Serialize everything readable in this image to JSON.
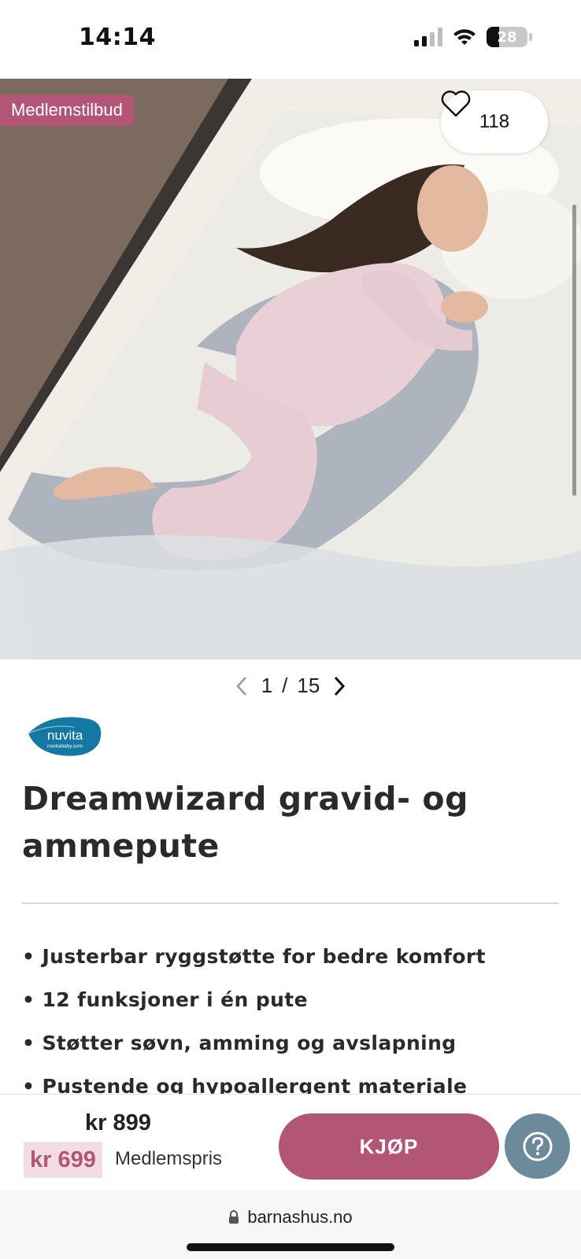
{
  "status_bar": {
    "time": "14:14",
    "battery": "28"
  },
  "hero": {
    "badge": "Medlemstilbud",
    "favorite_count": "118",
    "image_alt": "Gravid kvinne som sover med gravidpute"
  },
  "pager": {
    "current": "1",
    "separator": "/",
    "total": "15"
  },
  "brand": {
    "name": "nuvita",
    "tagline": "nuvitababy.com"
  },
  "product": {
    "title": "Dreamwizard gravid- og ammepute",
    "features": [
      "• Justerbar ryggstøtte for bedre komfort",
      "• 12 funksjoner i én pute",
      "• Støtter søvn, amming og avslapning",
      "• Pustende og hypoallergent materiale"
    ]
  },
  "buy_bar": {
    "regular_price": "kr 899",
    "member_price": "kr 699",
    "member_label": "Medlemspris",
    "buy_label": "KJØP"
  },
  "browser": {
    "url": "barnashus.no"
  },
  "colors": {
    "accent": "#b25576",
    "member_bg": "#f3dde4",
    "help_button": "#6b8b9a"
  },
  "icons": {
    "favorite": "heart-icon",
    "prev": "chevron-left-icon",
    "next": "chevron-right-icon",
    "help": "question-mark-icon",
    "lock": "lock-icon"
  }
}
